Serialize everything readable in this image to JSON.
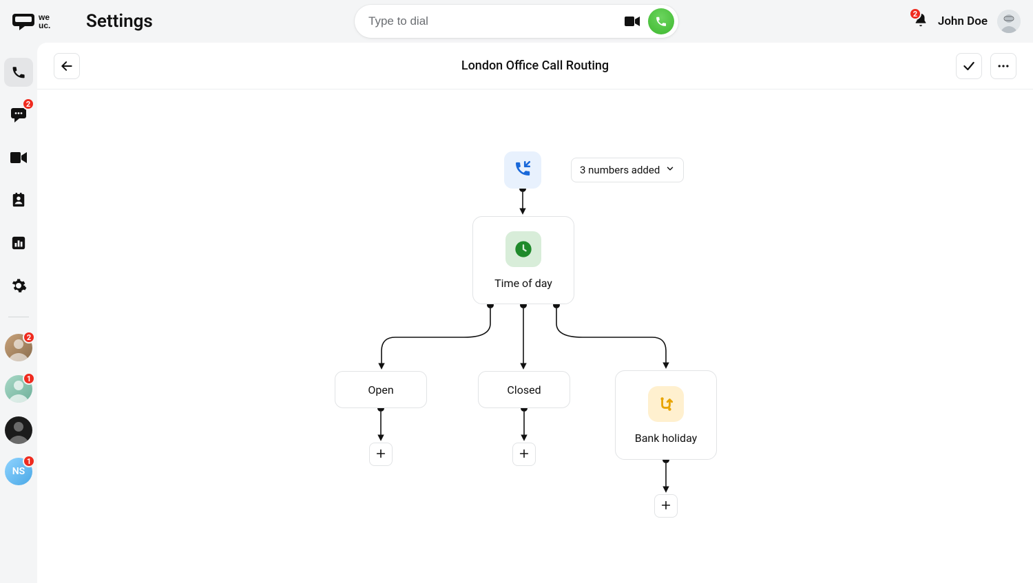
{
  "header": {
    "page_title": "Settings",
    "dial_placeholder": "Type to dial",
    "notification_count": "2",
    "user_name": "John Doe"
  },
  "sidebar": {
    "chat_badge": "2",
    "contact_1_badge": "2",
    "contact_2_badge": "1",
    "contact_4_badge": "1",
    "contact_4_initials": "NS"
  },
  "flow": {
    "title": "London Office Call Routing",
    "numbers_label": "3 numbers added",
    "time_of_day": "Time of day",
    "open": "Open",
    "closed": "Closed",
    "bank_holiday": "Bank holiday"
  }
}
